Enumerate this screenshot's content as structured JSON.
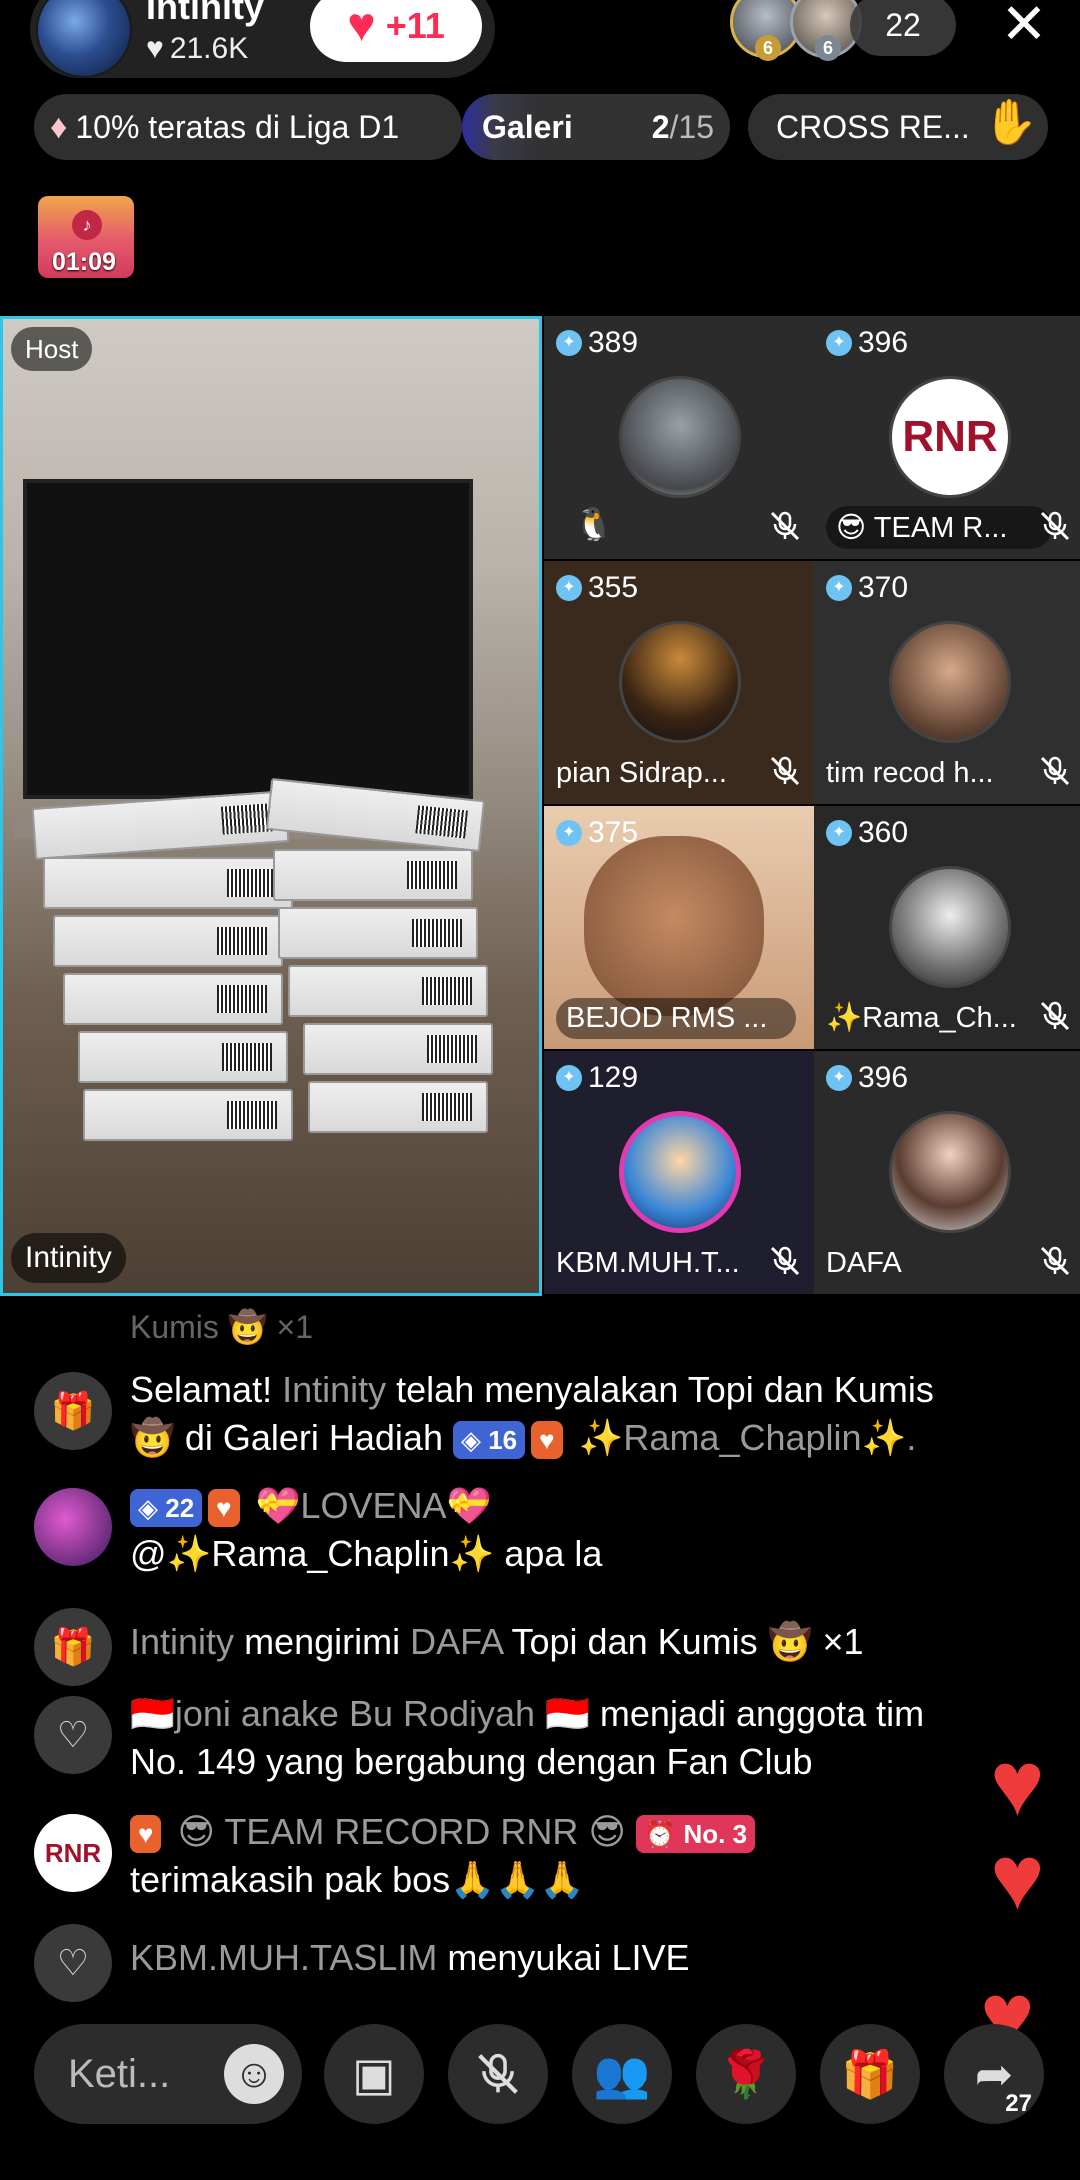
{
  "header": {
    "host_name": "Intinity",
    "host_likes": "21.6K",
    "follow_count": "+11",
    "viewer_badges": [
      "6",
      "6"
    ],
    "viewer_count": "22",
    "league_text": "10% teratas di Liga D1",
    "gallery_label": "Galeri",
    "gallery_count_current": "2",
    "gallery_count_total": "/15",
    "cross_label": "CROSS RE...",
    "timer": "01:09"
  },
  "host_video": {
    "label": "Host",
    "nickname": "Intinity"
  },
  "guests": [
    {
      "score": "389",
      "name": ""
    },
    {
      "score": "396",
      "name": "😎 TEAM R..."
    },
    {
      "score": "355",
      "name": "pian Sidrap..."
    },
    {
      "score": "370",
      "name": "tim recod h..."
    },
    {
      "score": "375",
      "name": "BEJOD RMS ..."
    },
    {
      "score": "360",
      "name": "✨Rama_Ch..."
    },
    {
      "score": "129",
      "name": "KBM.MUH.T..."
    },
    {
      "score": "396",
      "name": "DAFA"
    }
  ],
  "chat": {
    "ghost_line": "Kumis 🤠 ×1",
    "messages": [
      {
        "p1": "Selamat!",
        "host": "Intinity",
        "p2": "telah menyalakan Topi dan Kumis 🤠 di Galeri Hadiah",
        "level": "16",
        "user": "✨Rama_Chaplin✨."
      },
      {
        "level": "22",
        "user": "💝LOVENA💝",
        "text": "@✨Rama_Chaplin✨ apa la"
      },
      {
        "sender": "Intinity",
        "verb": "mengirimi",
        "receiver": "DAFA",
        "gift": "Topi dan Kumis 🤠 ×1"
      },
      {
        "user": "🇮🇩joni anake Bu Rodiyah 🇮🇩",
        "text": "menjadi anggota tim No. 149 yang bergabung dengan Fan Club"
      },
      {
        "user": "😎 TEAM RECORD RNR 😎",
        "rank": "No. 3",
        "text": "terimakasih pak bos🙏🙏🙏"
      },
      {
        "user": "KBM.MUH.TASLIM",
        "text": "menyukai LIVE"
      }
    ]
  },
  "bottom": {
    "comment_placeholder": "Keti...",
    "share_count": "27"
  },
  "colors": {
    "accent_red": "#fe2c55",
    "host_border": "#2ec6e8",
    "heart": "#ef3b3b"
  }
}
